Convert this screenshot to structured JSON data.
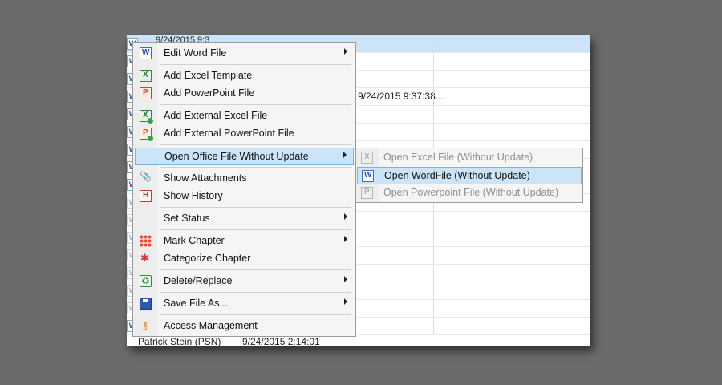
{
  "background_rows": {
    "top_timestamp": "9/24/2015 9:3",
    "mid_timestamp": "9/24/2015 9:37:38...",
    "bottom_author": "Patrick Stein (PSN)",
    "bottom_timestamp": "9/24/2015 2:14:01"
  },
  "context_menu": {
    "items": [
      {
        "label": "Edit Word File",
        "icon": "word-icon"
      },
      {
        "label": "Add Excel Template",
        "icon": "excel-icon"
      },
      {
        "label": "Add PowerPoint File",
        "icon": "powerpoint-icon"
      },
      {
        "label": "Add External Excel File",
        "icon": "excel-add-icon"
      },
      {
        "label": "Add External PowerPoint File",
        "icon": "powerpoint-add-icon"
      },
      {
        "label": "Open Office File Without Update"
      },
      {
        "label": "Show Attachments",
        "icon": "paperclip-icon"
      },
      {
        "label": "Show History",
        "icon": "history-icon"
      },
      {
        "label": "Set Status"
      },
      {
        "label": "Mark Chapter",
        "icon": "color-grid-icon"
      },
      {
        "label": "Categorize Chapter",
        "icon": "categorize-icon"
      },
      {
        "label": "Delete/Replace",
        "icon": "recycle-icon"
      },
      {
        "label": "Save File As...",
        "icon": "save-icon"
      },
      {
        "label": "Access Management",
        "icon": "key-icon"
      }
    ]
  },
  "submenu": {
    "items": [
      {
        "label": "Open Excel File (Without Update)",
        "state": "disabled"
      },
      {
        "label": "Open WordFile (Without Update)",
        "state": "highlighted"
      },
      {
        "label": "Open Powerpoint File (Without Update)",
        "state": "disabled"
      }
    ]
  },
  "colors": {
    "highlight": "#cce4f7",
    "highlight_border": "#7fb1e2",
    "selected_row": "#cde3f8",
    "backdrop": "#6b6b6b"
  }
}
